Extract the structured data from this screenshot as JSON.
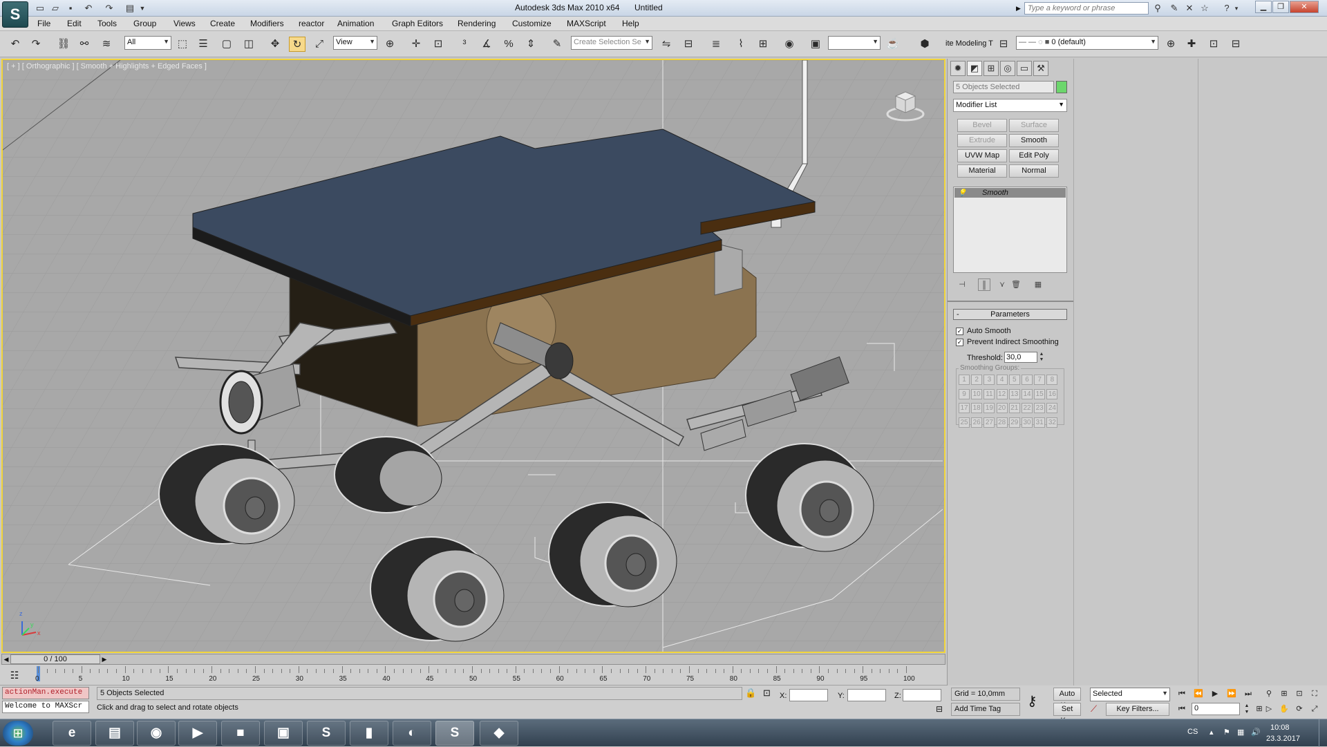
{
  "app": {
    "logo": "S",
    "title": "Autodesk 3ds Max  2010 x64",
    "document": "Untitled",
    "search_placeholder": "Type a keyword or phrase"
  },
  "menu": [
    "File",
    "Edit",
    "Tools",
    "Group",
    "Views",
    "Create",
    "Modifiers",
    "reactor",
    "Animation",
    "Graph Editors",
    "Rendering",
    "Customize",
    "MAXScript",
    "Help"
  ],
  "toolbar": {
    "selection_filter": "All",
    "ref_coord": "View",
    "named_selection_placeholder": "Create Selection Se",
    "ribbon_label": "ite Modeling T",
    "layer": "0 (default)"
  },
  "viewport": {
    "label": "[ + ] [ Orthographic ] [ Smooth + Highlights + Edged Faces ]",
    "axis_z": "z",
    "axis_x": "x",
    "axis_y": "y"
  },
  "command_panel": {
    "object_name": "5 Objects Selected",
    "modifier_list": "Modifier List",
    "modifier_buttons": [
      {
        "label": "Bevel",
        "enabled": false
      },
      {
        "label": "Surface",
        "enabled": false
      },
      {
        "label": "Extrude",
        "enabled": false
      },
      {
        "label": "Smooth",
        "enabled": true
      },
      {
        "label": "UVW Map",
        "enabled": true
      },
      {
        "label": "Edit Poly",
        "enabled": true
      },
      {
        "label": "Material",
        "enabled": true
      },
      {
        "label": "Normal",
        "enabled": true
      }
    ],
    "stack_item": "Smooth",
    "rollout_title": "Parameters",
    "rollout_collapse": "-",
    "auto_smooth_label": "Auto Smooth",
    "auto_smooth_checked": true,
    "prevent_label": "Prevent Indirect Smoothing",
    "prevent_checked": true,
    "threshold_label": "Threshold:",
    "threshold_value": "30,0",
    "smoothing_groups_label": "Smoothing Groups:",
    "smoothing_groups": [
      "1",
      "2",
      "3",
      "4",
      "5",
      "6",
      "7",
      "8",
      "9",
      "10",
      "11",
      "12",
      "13",
      "14",
      "15",
      "16",
      "17",
      "18",
      "19",
      "20",
      "21",
      "22",
      "23",
      "24",
      "25",
      "26",
      "27",
      "28",
      "29",
      "30",
      "31",
      "32"
    ]
  },
  "timeline": {
    "slider": "0 / 100",
    "ticks": [
      "0",
      "5",
      "10",
      "15",
      "20",
      "25",
      "30",
      "35",
      "40",
      "45",
      "50",
      "55",
      "60",
      "65",
      "70",
      "75",
      "80",
      "85",
      "90",
      "95",
      "100"
    ]
  },
  "status": {
    "maxscript_line1": "actionMan.execute",
    "maxscript_line2": "Welcome to MAXScr",
    "selection_info": "5 Objects Selected",
    "prompt": "Click and drag to select and rotate objects",
    "x_label": "X:",
    "y_label": "Y:",
    "z_label": "Z:",
    "grid": "Grid = 10,0mm",
    "add_time_tag": "Add Time Tag",
    "auto_key": "Auto Key",
    "set_key": "Set Key",
    "key_mode": "Selected",
    "key_filters": "Key Filters...",
    "frame": "0"
  },
  "taskbar": {
    "lang": "CS",
    "time": "10:08",
    "date": "23.3.2017"
  },
  "colors": {
    "viewport_bg": "#a8a8a8",
    "viewport_border": "#f1d43a",
    "panel_top": "#3b4a60",
    "rover_body": "#8b7350"
  }
}
